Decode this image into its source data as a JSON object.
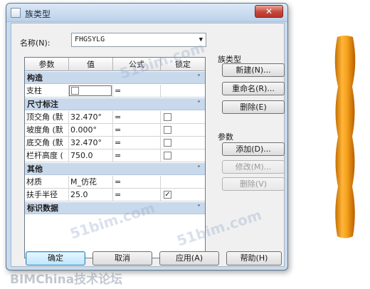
{
  "window": {
    "title": "族类型",
    "close_icon": "close-icon"
  },
  "name_field": {
    "label": "名称(N):",
    "value": "FHGSYLG"
  },
  "grid": {
    "headers": [
      "参数",
      "值",
      "公式",
      "锁定"
    ],
    "groups": [
      {
        "title": "构造",
        "chevron": "˄",
        "rows": [
          {
            "param": "支柱",
            "value": "",
            "formula": "=",
            "locked": "",
            "checkbox_in_value": true
          }
        ]
      },
      {
        "title": "尺寸标注",
        "chevron": "˄",
        "rows": [
          {
            "param": "顶交角 (默",
            "value": "32.470°",
            "formula": "=",
            "locked": ""
          },
          {
            "param": "坡度角 (默",
            "value": "0.000°",
            "formula": "=",
            "locked": ""
          },
          {
            "param": "底交角 (默",
            "value": "32.470°",
            "formula": "=",
            "locked": ""
          },
          {
            "param": "栏杆高度 (",
            "value": "750.0",
            "formula": "=",
            "locked": ""
          }
        ]
      },
      {
        "title": "其他",
        "chevron": "˄",
        "rows": [
          {
            "param": "材质",
            "value": "M_仿花",
            "formula": "=",
            "locked": null
          },
          {
            "param": "扶手半径",
            "value": "25.0",
            "formula": "=",
            "locked": "✓"
          }
        ]
      },
      {
        "title": "标识数据",
        "chevron": "˅",
        "rows": []
      }
    ]
  },
  "family_types": {
    "label": "族类型",
    "new": "新建(N)...",
    "rename": "重命名(R)...",
    "delete": "删除(E)"
  },
  "parameters": {
    "label": "参数",
    "add": "添加(D)...",
    "modify": "修改(M)...",
    "delete": "删除(V)"
  },
  "bottom_buttons": {
    "ok": "确定",
    "cancel": "取消",
    "apply": "应用(A)",
    "help": "帮助(H)"
  },
  "watermarks": {
    "site": "51bim.com",
    "footer": "BIMChina技术论坛"
  },
  "colors": {
    "railing": "#f0a21e",
    "group_header": "#c9d9ec",
    "frame": "#c8dbef"
  }
}
